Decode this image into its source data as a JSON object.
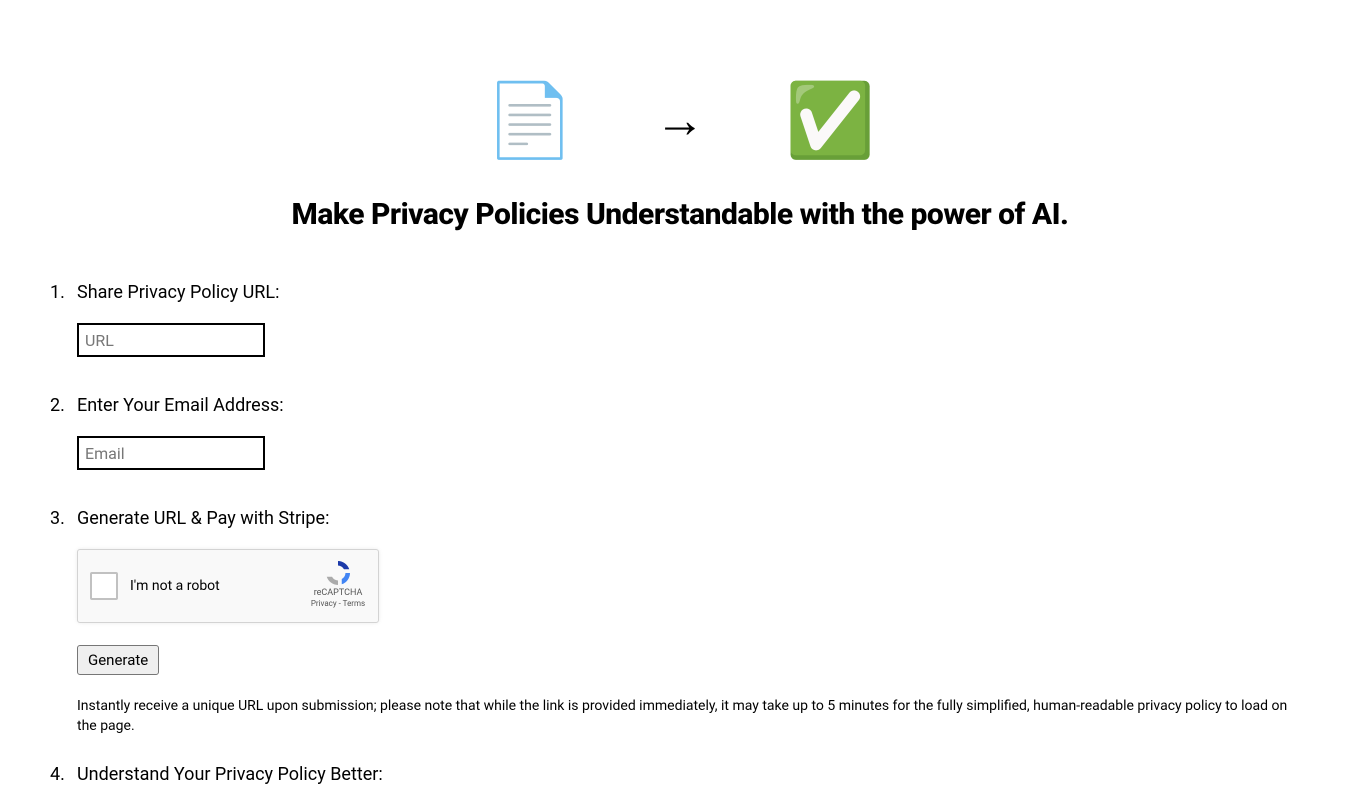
{
  "hero": {
    "doc_icon": "📄",
    "arrow_icon": "→",
    "check_icon": "✅"
  },
  "headline": "Make Privacy Policies Understandable with the power of AI.",
  "steps": {
    "step1": {
      "label": "Share Privacy Policy URL:",
      "placeholder": "URL"
    },
    "step2": {
      "label": "Enter Your Email Address:",
      "placeholder": "Email"
    },
    "step3": {
      "label": "Generate URL & Pay with Stripe:",
      "recaptcha_label": "I'm not a robot",
      "recaptcha_brand": "reCAPTCHA",
      "recaptcha_links": "Privacy - Terms",
      "button": "Generate",
      "note": "Instantly receive a unique URL upon submission; please note that while the link is provided immediately, it may take up to 5 minutes for the fully simplified, human-readable privacy policy to load on the page."
    },
    "step4": {
      "label": "Understand Your Privacy Policy Better:"
    }
  }
}
